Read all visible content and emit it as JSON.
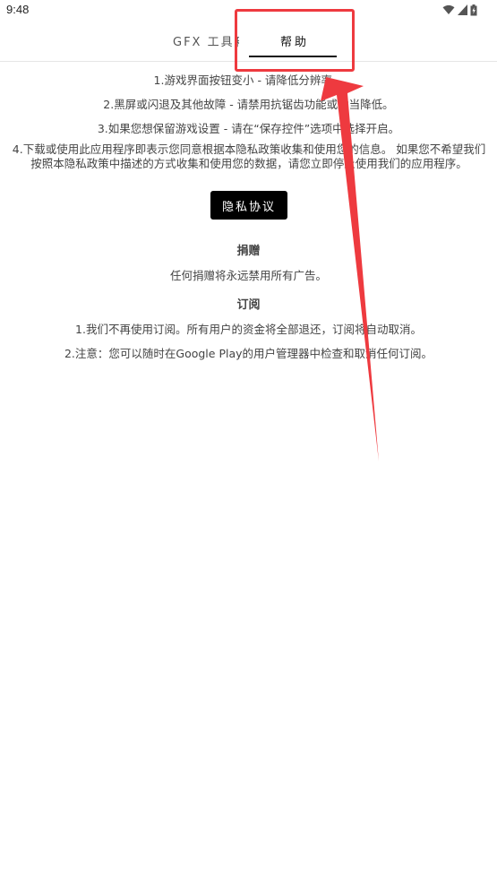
{
  "status_bar": {
    "time": "9:48",
    "icons": [
      "wifi-icon",
      "signal-icon",
      "battery-icon"
    ]
  },
  "tabs": [
    {
      "label": "GFX 工具箱",
      "selected": false
    },
    {
      "label": "帮助",
      "selected": true
    }
  ],
  "help": {
    "tips": [
      "1.游戏界面按钮变小 - 请降低分辨率。",
      "2.黑屏或闪退及其他故障 - 请禁用抗锯齿功能或适当降低。",
      "3.如果您想保留游戏设置 - 请在“保存控件”选项中选择开启。"
    ],
    "privacy_notice": "4.下载或使用此应用程序即表示您同意根据本隐私政策收集和使用您的信息。 如果您不希望我们按照本隐私政策中描述的方式收集和使用您的数据，请您立即停止使用我们的应用程序。",
    "privacy_button_label": "隐私协议"
  },
  "donation": {
    "title": "捐赠",
    "text": "任何捐赠将永远禁用所有广告。"
  },
  "subscription": {
    "title": "订阅",
    "items": [
      "1.我们不再使用订阅。所有用户的资金将全部退还，订阅将自动取消。",
      "2.注意：您可以随时在Google Play的用户管理器中检查和取消任何订阅。"
    ]
  },
  "colors": {
    "annotation_red": "#ee3a3f",
    "button_bg": "#000000",
    "tab_indicator": "#111111"
  }
}
